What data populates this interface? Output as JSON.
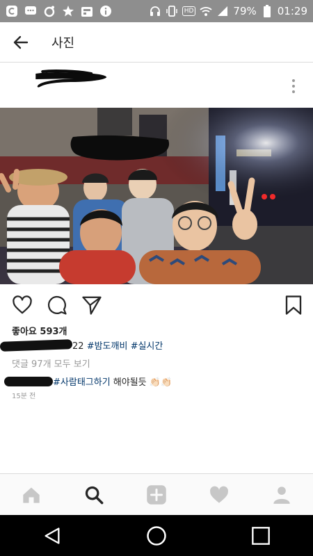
{
  "status_bar": {
    "battery_percent": "79%",
    "time": "01:29",
    "hd_label": "HD",
    "icons": [
      "app-icon",
      "chat-icon",
      "ring-icon",
      "star-icon",
      "calendar-icon",
      "info-icon",
      "headset-icon",
      "vibrate-icon",
      "wifi-icon",
      "signal-icon",
      "battery-icon"
    ]
  },
  "app_bar": {
    "title": "사진"
  },
  "post": {
    "likes": "좋아요 593개",
    "caption_tail": "22 ",
    "caption_tag1": "#밤도깨비",
    "caption_tag2": "#실시간",
    "view_comments": "댓글 97개 모두 보기",
    "comment_tag": "#사람태그하기",
    "comment_text": " 해야될듯 👏🏻👏🏻",
    "timestamp": "15분 전"
  },
  "colors": {
    "hashtag": "#003569",
    "muted": "#999999",
    "text": "#262626",
    "status_bar": "#8e8e8e"
  },
  "bottom_nav": [
    "home-icon",
    "search-icon",
    "add-icon",
    "heart-icon",
    "profile-icon"
  ],
  "system_nav": [
    "back-triangle-icon",
    "home-circle-icon",
    "recents-square-icon"
  ]
}
